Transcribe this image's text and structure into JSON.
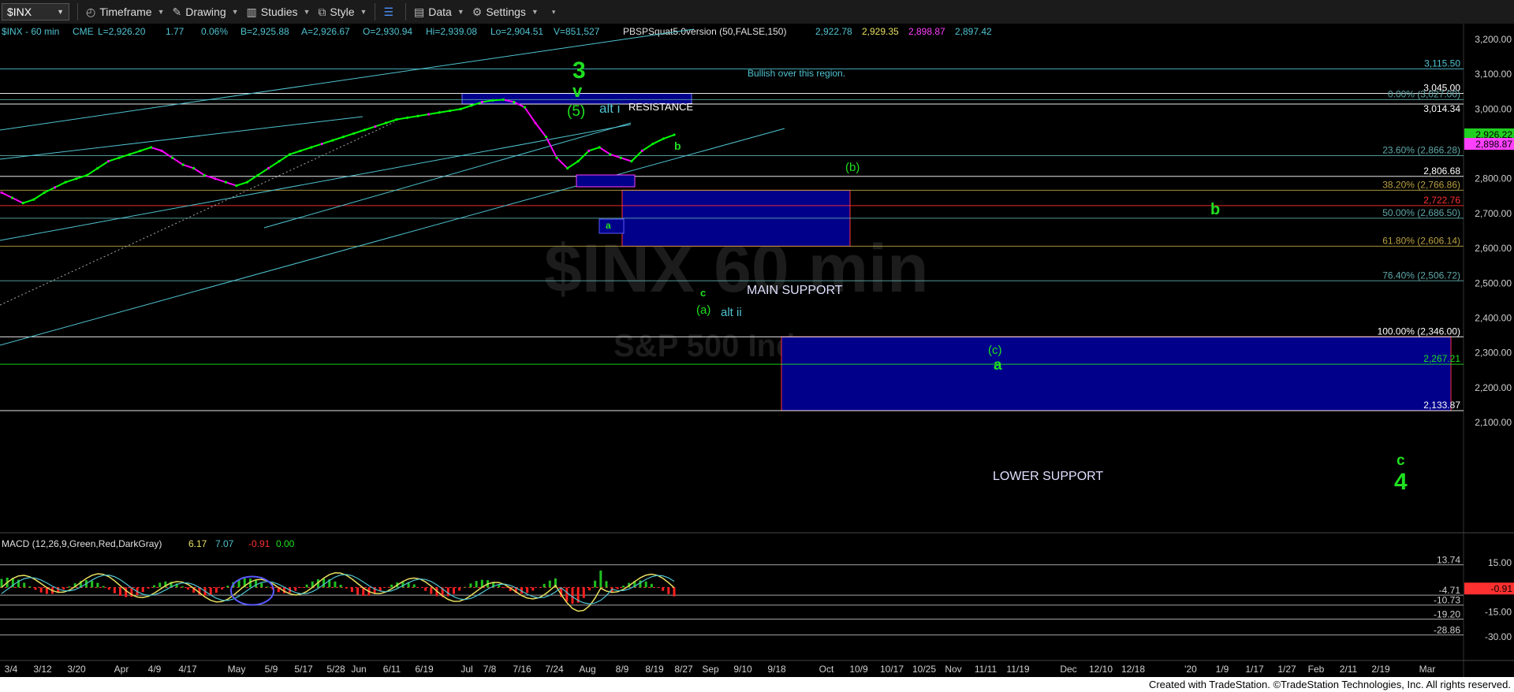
{
  "toolbar": {
    "symbol": "$INX",
    "timeframe": "Timeframe",
    "drawing": "Drawing",
    "studies": "Studies",
    "style": "Style",
    "data": "Data",
    "settings": "Settings"
  },
  "header": {
    "symbol_info": "$INX - 60 min",
    "exchange": "CME",
    "last": "L=2,926.20",
    "change": "1.77",
    "change_pct": "0.06%",
    "bid": "B=2,925.88",
    "ask": "A=2,926.67",
    "open": "O=2,930.94",
    "high": "Hi=2,939.08",
    "low": "Lo=2,904.51",
    "volume": "V=851,527",
    "study_name": "PBSPSquat5.0version (50,FALSE,150)",
    "study_values": [
      "2,922.78",
      "2,929.35",
      "2,898.87",
      "2,897.42"
    ]
  },
  "watermark": {
    "symbol": "$INX 60 min",
    "name": "S&P 500 Index"
  },
  "footer": "Created with TradeStation. ©TradeStation Technologies, Inc. All rights reserved.",
  "colors": {
    "up": "#00ff00",
    "down": "#ff00ff",
    "channel": "#4fc3d0",
    "zone": "#00008b",
    "zone_border": "#5a5aff",
    "grid_label": "#cfcfcf",
    "fib": "#5fa8a8",
    "green_label": "#20e020"
  },
  "chart_data": [
    {
      "type": "line",
      "title": "$INX - 60 min",
      "series": [
        {
          "name": "",
          "values": [
            2760,
            2745,
            2730,
            2740,
            2760,
            2775,
            2790,
            2800,
            2810,
            2830,
            2850,
            2860,
            2870,
            2880,
            2890,
            2880,
            2860,
            2840,
            2830,
            2810,
            2800,
            2790,
            2780,
            2790,
            2810,
            2830,
            2850,
            2870,
            2880,
            2890,
            2900,
            2910,
            2920,
            2930,
            2940,
            2950,
            2960,
            2970,
            2975,
            2980,
            2985,
            2990,
            2995,
            3000,
            3010,
            3020,
            3025,
            3027,
            3020,
            3005,
            2960,
            2920,
            2860,
            2830,
            2850,
            2880,
            2890,
            2870,
            2860,
            2850,
            2880,
            2900,
            2915,
            2926
          ]
        }
      ],
      "ylim": [
        2050,
        3250
      ],
      "y_ticks": [
        "3,200.00",
        "3,100.00",
        "3,000.00",
        "2,900.00",
        "2,800.00",
        "2,700.00",
        "2,600.00",
        "2,500.00",
        "2,400.00",
        "2,300.00",
        "2,200.00",
        "2,100.00"
      ],
      "x_ticks": [
        "3/4",
        "3/12",
        "3/20",
        "Apr",
        "4/9",
        "4/17",
        "May",
        "5/9",
        "5/17",
        "5/28",
        "Jun",
        "6/11",
        "6/19",
        "Jul",
        "7/8",
        "7/16",
        "7/24",
        "Aug",
        "8/9",
        "8/19",
        "8/27",
        "Sep",
        "9/10",
        "9/18",
        "Oct",
        "10/9",
        "10/17",
        "10/25",
        "Nov",
        "11/11",
        "11/19",
        "Dec",
        "12/10",
        "12/18",
        "'20",
        "1/9",
        "1/17",
        "1/27",
        "Feb",
        "2/11",
        "2/19",
        "Mar"
      ],
      "horizontal_levels": [
        {
          "value": 3115.5,
          "label": "3,115.50",
          "color": "#4fc3d0"
        },
        {
          "value": 3045.0,
          "label": "3,045.00",
          "color": "#ffffff"
        },
        {
          "value": 3027.0,
          "label": "0.00% (3,027.00)",
          "color": "#5fa8a8"
        },
        {
          "value": 3014.34,
          "label": "3,014.34",
          "color": "#ffffff"
        },
        {
          "value": 2866.28,
          "label": "23.60% (2,866.28)",
          "color": "#5fa8a8"
        },
        {
          "value": 2806.68,
          "label": "2,806.68",
          "color": "#ffffff"
        },
        {
          "value": 2766.86,
          "label": "38.20% (2,766.86)",
          "color": "#b8a040"
        },
        {
          "value": 2722.76,
          "label": "2,722.76",
          "color": "#ff3030"
        },
        {
          "value": 2686.5,
          "label": "50.00% (2,686.50)",
          "color": "#5fa8a8"
        },
        {
          "value": 2606.14,
          "label": "61.80% (2,606.14)",
          "color": "#b8a040"
        },
        {
          "value": 2506.72,
          "label": "76.40% (2,506.72)",
          "color": "#5fa8a8"
        },
        {
          "value": 2346.0,
          "label": "100.00% (2,346.00)",
          "color": "#ffffff"
        },
        {
          "value": 2267.21,
          "label": "2,267.21",
          "color": "#20e020"
        },
        {
          "value": 2133.87,
          "label": "2,133.87",
          "color": "#ffffff"
        }
      ],
      "price_tags": [
        {
          "value": 2926.22,
          "label": "2,926.22",
          "color": "#20d020"
        },
        {
          "value": 2898.87,
          "label": "2,898.87",
          "color": "#ff40ff"
        }
      ],
      "zones": [
        {
          "name": "RESISTANCE",
          "low": 3014.34,
          "high": 3045.0
        },
        {
          "name": "MAIN SUPPORT",
          "low": 2606.14,
          "high": 2766.86
        },
        {
          "name": "LOWER SUPPORT",
          "low": 2133.87,
          "high": 2346.0
        }
      ],
      "annotations": [
        "Bullish over this region.",
        "3",
        "v",
        "(5)",
        "alt i",
        "RESISTANCE",
        "b",
        "(b)",
        "b",
        "a",
        "c",
        "(a)",
        "alt ii",
        "(c)",
        "a",
        "c",
        "4",
        "MAIN SUPPORT",
        "LOWER SUPPORT"
      ]
    },
    {
      "type": "line",
      "title": "MACD (12,26,9,Green,Red,DarkGray)",
      "series": [
        {
          "name": "MACD",
          "values": [
            6.17
          ]
        },
        {
          "name": "Signal",
          "values": [
            7.07
          ]
        },
        {
          "name": "Diff",
          "values": [
            -0.91
          ]
        },
        {
          "name": "Zero",
          "values": [
            0.0
          ]
        }
      ],
      "legend_values": [
        "6.17",
        "7.07",
        "-0.91",
        "0.00"
      ],
      "ylim": [
        -34,
        20
      ],
      "y_ticks": [
        "15.00",
        "0.00",
        "-15.00",
        "-30.00"
      ],
      "horizontal_levels": [
        {
          "value": 13.74,
          "label": "13.74"
        },
        {
          "value": -4.71,
          "label": "-4.71"
        },
        {
          "value": -10.73,
          "label": "-10.73"
        },
        {
          "value": -19.2,
          "label": "-19.20"
        },
        {
          "value": -28.86,
          "label": "-28.86"
        }
      ],
      "price_tag": {
        "value": -0.91,
        "label": "-0.91"
      }
    }
  ]
}
